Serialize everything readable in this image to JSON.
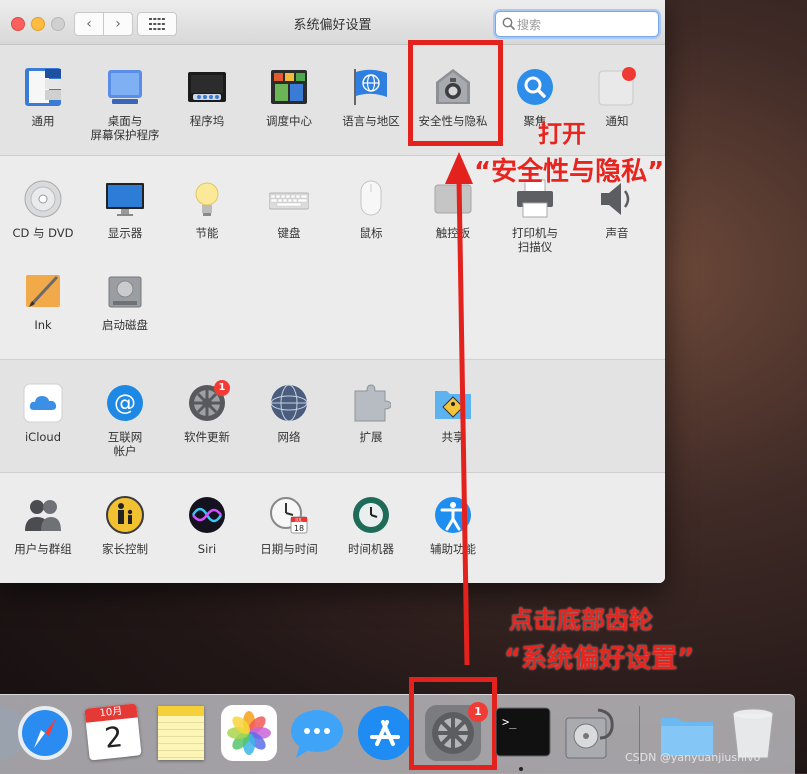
{
  "window": {
    "title": "系统偏好设置",
    "search_placeholder": "搜索",
    "nav_back": "‹",
    "nav_fwd": "›"
  },
  "sections": {
    "personal": [
      {
        "label": "通用",
        "icon": "general-icon"
      },
      {
        "label": "桌面与\n屏幕保护程序",
        "icon": "desktop-screensaver-icon"
      },
      {
        "label": "程序坞",
        "icon": "dock-icon"
      },
      {
        "label": "调度中心",
        "icon": "mission-control-icon"
      },
      {
        "label": "语言与地区",
        "icon": "language-region-icon"
      },
      {
        "label": "安全性与隐私",
        "icon": "security-privacy-icon"
      },
      {
        "label": "聚焦",
        "icon": "spotlight-icon"
      },
      {
        "label": "通知",
        "icon": "notifications-icon"
      }
    ],
    "hardware": [
      {
        "label": "CD 与 DVD",
        "icon": "cd-dvd-icon"
      },
      {
        "label": "显示器",
        "icon": "displays-icon"
      },
      {
        "label": "节能",
        "icon": "energy-saver-icon"
      },
      {
        "label": "键盘",
        "icon": "keyboard-icon"
      },
      {
        "label": "鼠标",
        "icon": "mouse-icon"
      },
      {
        "label": "触控板",
        "icon": "trackpad-icon"
      },
      {
        "label": "打印机与\n扫描仪",
        "icon": "printers-scanners-icon"
      },
      {
        "label": "声音",
        "icon": "sound-icon"
      },
      {
        "label": "Ink",
        "icon": "ink-icon"
      },
      {
        "label": "启动磁盘",
        "icon": "startup-disk-icon"
      }
    ],
    "internet": [
      {
        "label": "iCloud",
        "icon": "icloud-icon"
      },
      {
        "label": "互联网\n帐户",
        "icon": "internet-accounts-icon"
      },
      {
        "label": "软件更新",
        "icon": "software-update-icon",
        "badge": "1"
      },
      {
        "label": "网络",
        "icon": "network-icon"
      },
      {
        "label": "扩展",
        "icon": "extensions-icon"
      },
      {
        "label": "共享",
        "icon": "sharing-icon"
      }
    ],
    "system": [
      {
        "label": "用户与群组",
        "icon": "users-groups-icon"
      },
      {
        "label": "家长控制",
        "icon": "parental-controls-icon"
      },
      {
        "label": "Siri",
        "icon": "siri-icon"
      },
      {
        "label": "日期与时间",
        "icon": "date-time-icon"
      },
      {
        "label": "时间机器",
        "icon": "time-machine-icon"
      },
      {
        "label": "辅助功能",
        "icon": "accessibility-icon"
      }
    ]
  },
  "annotations": {
    "open_line1": "打开",
    "open_line2": "“安全性与隐私”",
    "click_line1": "点击底部齿轮",
    "click_line2": "“系统偏好设置”",
    "highlight_color": "#e3221e"
  },
  "dock": {
    "calendar_month": "10月",
    "calendar_day": "2",
    "sysprefs_badge": "1",
    "apps": [
      "safari-icon",
      "calendar-icon",
      "notes-icon",
      "photos-icon",
      "messages-icon",
      "app-store-icon",
      "system-preferences-icon",
      "terminal-icon",
      "disk-utility-icon",
      "folder-icon",
      "trash-icon"
    ]
  },
  "watermark": "CSDN @yanyuanjiushivo",
  "date_time_icon_text": {
    "month": "JUL",
    "day": "18"
  }
}
